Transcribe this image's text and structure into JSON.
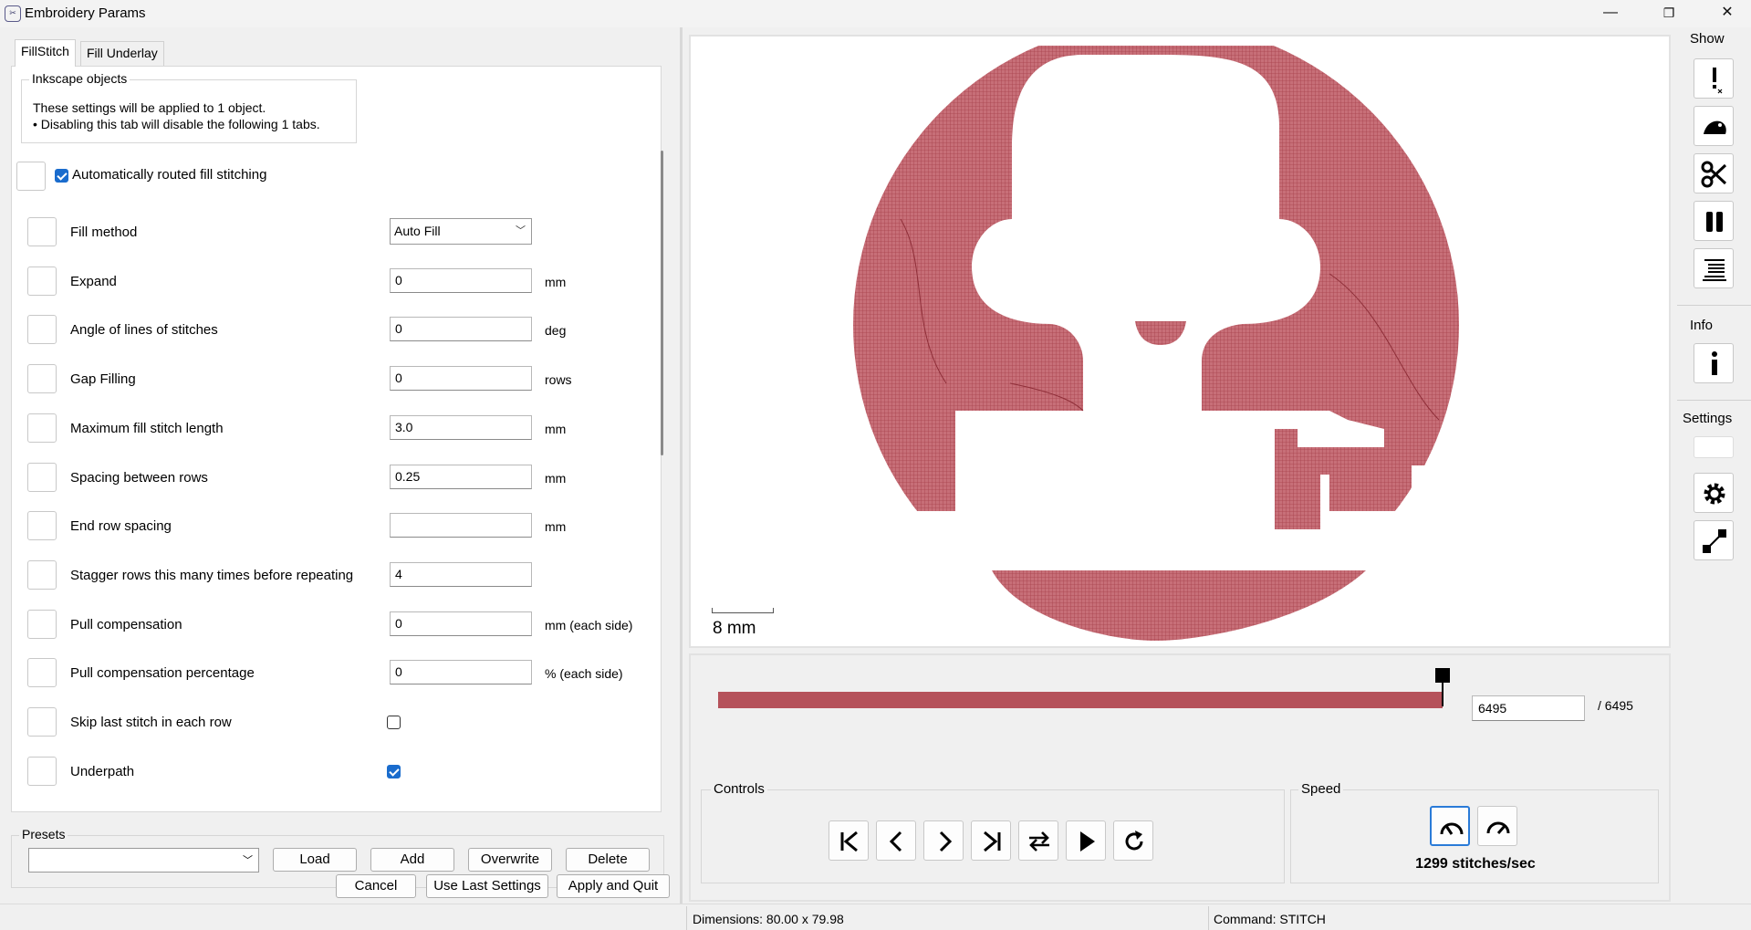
{
  "window": {
    "title": "Embroidery Params",
    "minimize": "—",
    "maximize": "❐",
    "close": "✕"
  },
  "tabs": [
    {
      "label": "FillStitch",
      "active": true
    },
    {
      "label": "Fill Underlay",
      "active": false
    }
  ],
  "inkscape": {
    "title": "Inkscape objects",
    "line1": "These settings will be applied to 1 object.",
    "line2": "• Disabling this tab will disable the following 1 tabs."
  },
  "auto_routed": {
    "label": "Automatically routed fill stitching",
    "checked": true
  },
  "params": [
    {
      "label": "Fill method",
      "type": "select",
      "value": "Auto Fill",
      "unit": ""
    },
    {
      "label": "Expand",
      "type": "text",
      "value": "0",
      "unit": "mm"
    },
    {
      "label": "Angle of lines of stitches",
      "type": "text",
      "value": "0",
      "unit": "deg"
    },
    {
      "label": "Gap Filling",
      "type": "text",
      "value": "0",
      "unit": "rows"
    },
    {
      "label": "Maximum fill stitch length",
      "type": "text",
      "value": "3.0",
      "unit": "mm"
    },
    {
      "label": "Spacing between rows",
      "type": "text",
      "value": "0.25",
      "unit": "mm"
    },
    {
      "label": "End row spacing",
      "type": "text",
      "value": "",
      "unit": "mm"
    },
    {
      "label": "Stagger rows this many times before repeating",
      "type": "text",
      "value": "4",
      "unit": ""
    },
    {
      "label": "Pull compensation",
      "type": "text",
      "value": "0",
      "unit": "mm (each side)"
    },
    {
      "label": "Pull compensation percentage",
      "type": "text",
      "value": "0",
      "unit": "% (each side)"
    },
    {
      "label": "Skip last stitch in each row",
      "type": "checkbox",
      "value": false,
      "unit": ""
    },
    {
      "label": "Underpath",
      "type": "checkbox",
      "value": true,
      "unit": ""
    }
  ],
  "presets": {
    "title": "Presets",
    "selected": "",
    "load": "Load",
    "add": "Add",
    "overwrite": "Overwrite",
    "delete": "Delete"
  },
  "footer": {
    "cancel": "Cancel",
    "use_last": "Use Last Settings",
    "apply": "Apply and Quit"
  },
  "preview": {
    "scale_label": "8 mm",
    "fill_color": "#b5525b"
  },
  "progress": {
    "current": "6495",
    "total": "/ 6495",
    "fraction": 1.0
  },
  "controls": {
    "title": "Controls",
    "buttons": [
      "go-to-start-icon",
      "step-back-icon",
      "step-forward-icon",
      "go-to-end-icon",
      "direction-swap-icon",
      "play-icon",
      "restart-icon"
    ]
  },
  "speed": {
    "title": "Speed",
    "text": "1299 stitches/sec"
  },
  "rightbar": {
    "show_label": "Show",
    "info_label": "Info",
    "settings_label": "Settings"
  },
  "status": {
    "dimensions": "Dimensions: 80.00 x 79.98",
    "command": "Command: STITCH"
  }
}
